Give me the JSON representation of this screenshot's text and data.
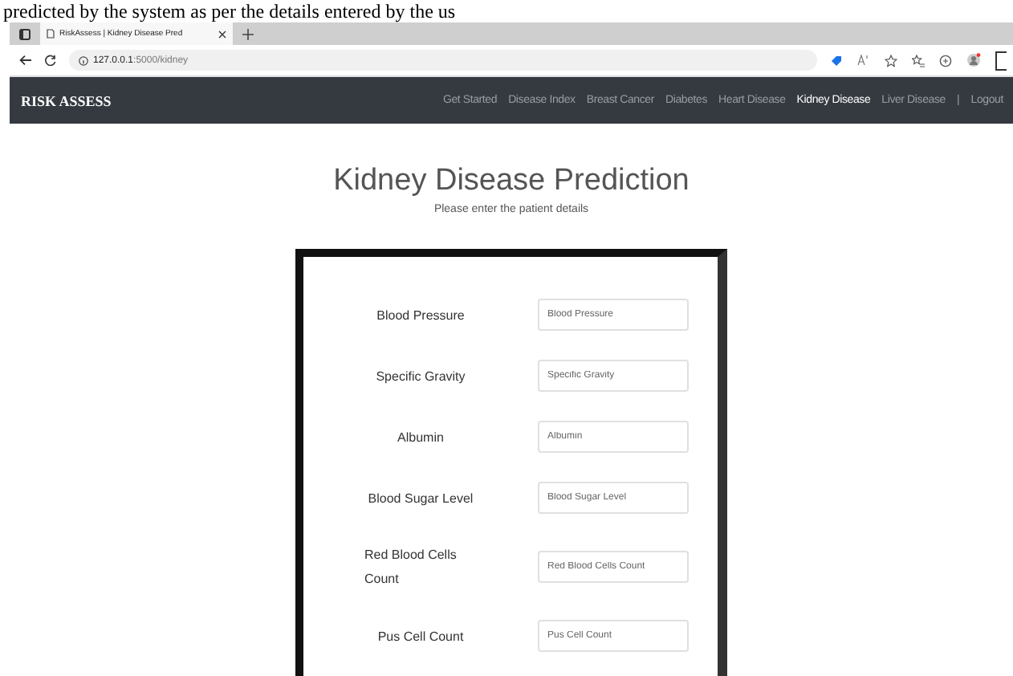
{
  "document_text": "predicted by the system as per the details entered by the us",
  "browser": {
    "tab_title": "RiskAssess | Kidney Disease Pred",
    "url_host": "127.0.0.1",
    "url_path": ":5000/kidney"
  },
  "navbar": {
    "brand": "RISK ASSESS",
    "links": [
      {
        "label": "Get Started",
        "selected": false
      },
      {
        "label": "Disease Index",
        "selected": false
      },
      {
        "label": "Breast Cancer",
        "selected": false
      },
      {
        "label": "Diabetes",
        "selected": false
      },
      {
        "label": "Heart Disease",
        "selected": false
      },
      {
        "label": "Kidney Disease",
        "selected": true
      },
      {
        "label": "Liver Disease",
        "selected": false
      }
    ],
    "separator": "|",
    "logout": "Logout"
  },
  "page": {
    "title": "Kidney Disease Prediction",
    "subtitle": "Please enter the patient details"
  },
  "form": {
    "fields": [
      {
        "label": "Blood Pressure",
        "placeholder": "Blood Pressure"
      },
      {
        "label": "Specific Gravity",
        "placeholder": "Specific Gravity"
      },
      {
        "label": "Albumin",
        "placeholder": "Albumin"
      },
      {
        "label": "Blood Sugar Level",
        "placeholder": "Blood Sugar Level"
      },
      {
        "label": "Red Blood Cells Count",
        "placeholder": "Red Blood Cells Count"
      },
      {
        "label": "Pus Cell Count",
        "placeholder": "Pus Cell Count"
      }
    ]
  }
}
